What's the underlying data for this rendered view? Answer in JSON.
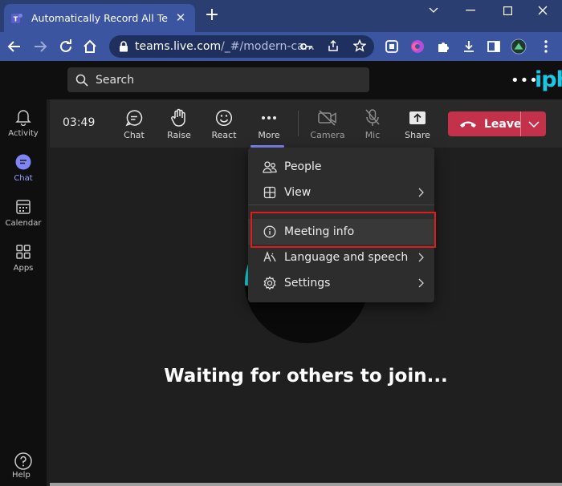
{
  "browser": {
    "tab_title": "Automatically Record All Teams M",
    "url_host": "teams.live.com",
    "url_path": "/_#/modern-ca..."
  },
  "header": {
    "search_placeholder": "Search",
    "brand": "iph"
  },
  "rail": {
    "items": [
      {
        "label": "Activity",
        "icon": "bell-icon"
      },
      {
        "label": "Chat",
        "icon": "chat-icon",
        "active": true
      },
      {
        "label": "Calendar",
        "icon": "calendar-icon"
      },
      {
        "label": "Apps",
        "icon": "apps-icon"
      }
    ],
    "help_label": "Help"
  },
  "call": {
    "timer": "03:49",
    "controls": {
      "chat": "Chat",
      "raise": "Raise",
      "react": "React",
      "more": "More",
      "camera": "Camera",
      "mic": "Mic",
      "share": "Share"
    },
    "leave_label": "Leave",
    "waiting_text": "Waiting for others to join..."
  },
  "more_menu": {
    "items": [
      {
        "label": "People",
        "icon": "people-icon",
        "submenu": false
      },
      {
        "label": "View",
        "icon": "view-grid-icon",
        "submenu": true
      },
      {
        "label": "Meeting info",
        "icon": "info-icon",
        "submenu": false,
        "highlighted": true
      },
      {
        "label": "Language and speech",
        "icon": "language-icon",
        "submenu": true
      },
      {
        "label": "Settings",
        "icon": "gear-icon",
        "submenu": true
      }
    ]
  },
  "colors": {
    "accent": "#7f85f5",
    "leave": "#c4314b",
    "highlight": "#e01b1b",
    "browser_frame": "#3c55a0"
  }
}
